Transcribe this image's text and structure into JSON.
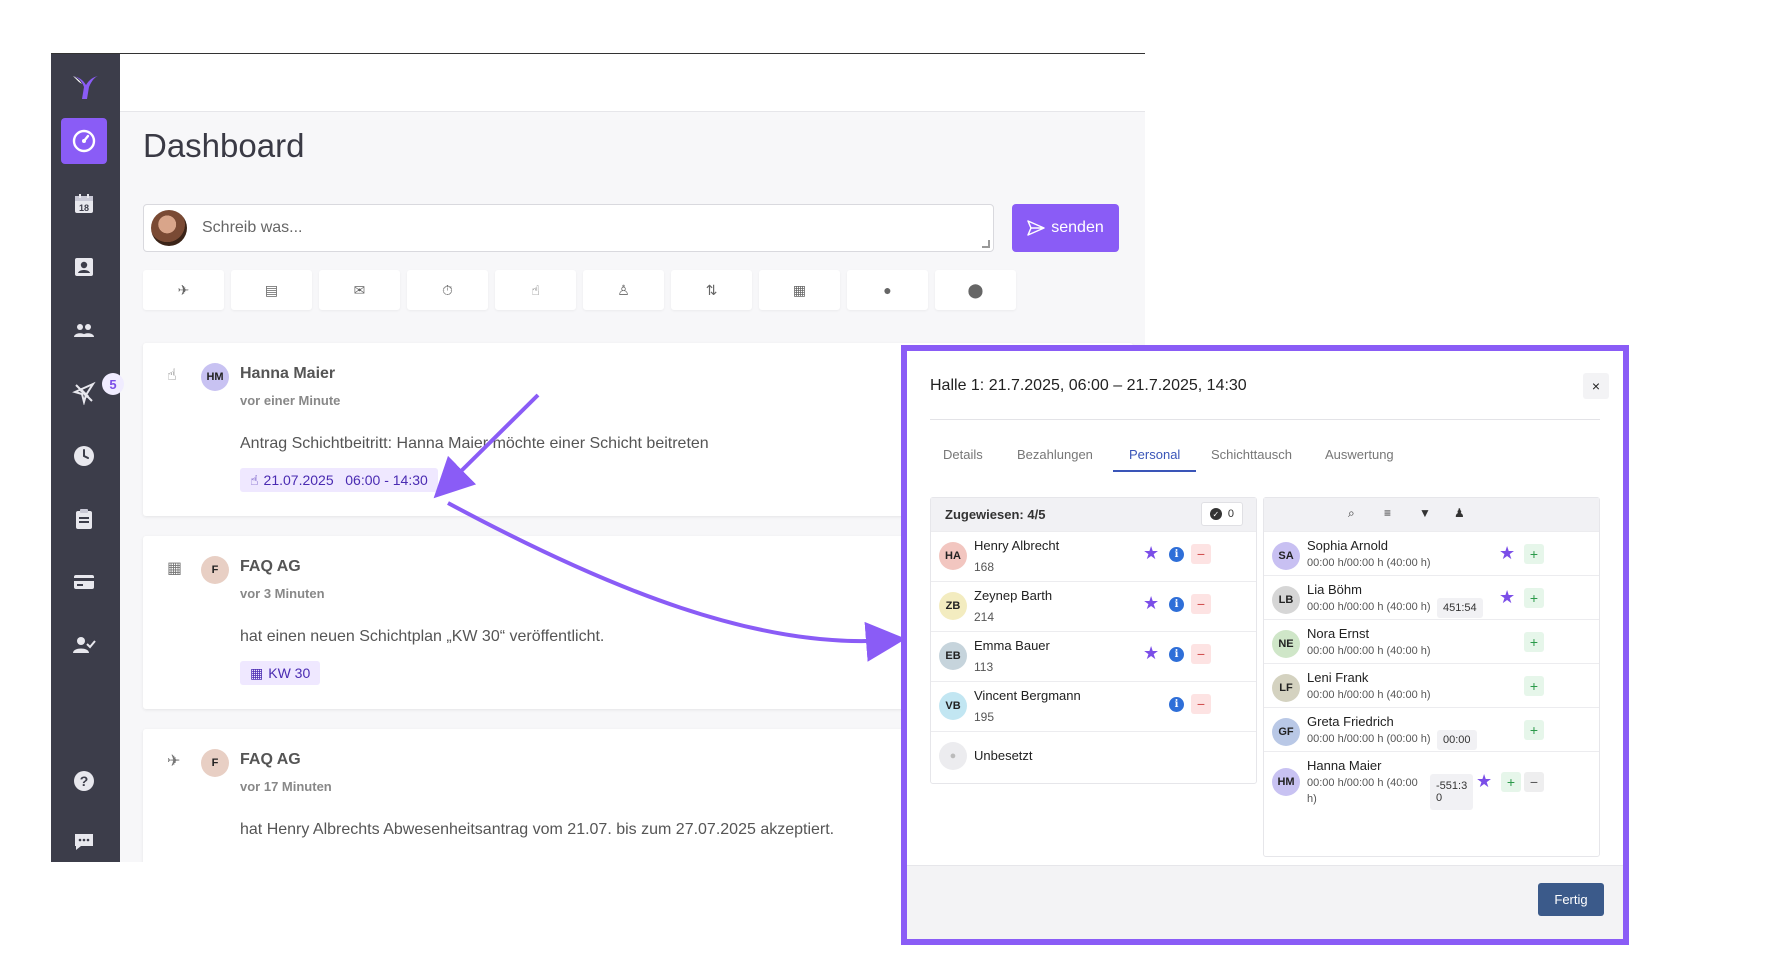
{
  "sidebar": {
    "badge_count": "5",
    "items": [
      {
        "name": "dashboard",
        "icon": "gauge-icon",
        "glyph": "◔",
        "active": true
      },
      {
        "name": "calendar",
        "icon": "calendar-icon",
        "glyph": "18"
      },
      {
        "name": "contacts",
        "icon": "contact-card-icon",
        "glyph": "👤"
      },
      {
        "name": "team",
        "icon": "users-icon",
        "glyph": "👥"
      },
      {
        "name": "absences",
        "icon": "airplane-icon",
        "glyph": "✈"
      },
      {
        "name": "time",
        "icon": "clock-icon",
        "glyph": "🕓"
      },
      {
        "name": "reports",
        "icon": "clipboard-icon",
        "glyph": "📋"
      },
      {
        "name": "payments",
        "icon": "credit-card-icon",
        "glyph": "💳"
      },
      {
        "name": "approvals",
        "icon": "user-check-icon",
        "glyph": "👤"
      },
      {
        "name": "help",
        "icon": "help-icon",
        "glyph": "?"
      },
      {
        "name": "chat",
        "icon": "chat-icon",
        "glyph": "💬"
      }
    ]
  },
  "dashboard": {
    "title": "Dashboard",
    "composer_placeholder": "Schreib was...",
    "send_label": "senden"
  },
  "quick_actions": [
    {
      "icon": "airplane-icon",
      "glyph": "✈"
    },
    {
      "icon": "clipboard-icon",
      "glyph": "▤"
    },
    {
      "icon": "mail-icon",
      "glyph": "✉"
    },
    {
      "icon": "stopwatch-icon",
      "glyph": "⏱"
    },
    {
      "icon": "hand-pointer-icon",
      "glyph": "☝"
    },
    {
      "icon": "person-add-icon",
      "glyph": "♙"
    },
    {
      "icon": "swap-icon",
      "glyph": "⇅"
    },
    {
      "icon": "calendar-icon",
      "glyph": "▦"
    },
    {
      "icon": "check-circle-icon",
      "glyph": "●"
    },
    {
      "icon": "location-pin-icon",
      "glyph": "⬤"
    }
  ],
  "feed": [
    {
      "icon": "hand-pointer-icon",
      "glyph": "☝",
      "initials": "HM",
      "avatar_color": "#c8c2f2",
      "name": "Hanna Maier",
      "time": "vor einer Minute",
      "text": "Antrag Schichtbeitritt: Hanna Maier möchte einer Schicht beitreten",
      "chip_icon": "☝",
      "chip": "21.07.2025   06:00 - 14:30"
    },
    {
      "icon": "calendar-icon",
      "glyph": "▦",
      "initials": "F",
      "avatar_color": "#e8cfc4",
      "name": "FAQ AG",
      "time": "vor 3 Minuten",
      "text": "hat einen neuen Schichtplan „KW 30“ veröffentlicht.",
      "chip_icon": "▦",
      "chip": "KW 30"
    },
    {
      "icon": "airplane-icon",
      "glyph": "✈",
      "initials": "F",
      "avatar_color": "#e8cfc4",
      "name": "FAQ AG",
      "time": "vor 17 Minuten",
      "text": "hat Henry Albrechts Abwesenheitsantrag vom 21.07. bis zum 27.07.2025 akzeptiert."
    }
  ],
  "modal": {
    "title": "Halle 1: 21.7.2025, 06:00 – 21.7.2025, 14:30",
    "close": "×",
    "tabs": [
      "Details",
      "Bezahlungen",
      "Personal",
      "Schichttausch",
      "Auswertung"
    ],
    "active_tab": "Personal",
    "assigned": {
      "title": "Zugewiesen: 4/5",
      "count": "0",
      "people": [
        {
          "initials": "HA",
          "name": "Henry Albrecht",
          "sub": "168",
          "color": "#f2c6c0",
          "star": true
        },
        {
          "initials": "ZB",
          "name": "Zeynep Barth",
          "sub": "214",
          "color": "#f3ecc0",
          "star": true
        },
        {
          "initials": "EB",
          "name": "Emma Bauer",
          "sub": "113",
          "color": "#c6d4dc",
          "star": true
        },
        {
          "initials": "VB",
          "name": "Vincent Bergmann",
          "sub": "195",
          "color": "#c2e6f2",
          "star": false
        }
      ],
      "unassigned_label": "Unbesetzt"
    },
    "available": {
      "people": [
        {
          "initials": "SA",
          "name": "Sophia Arnold",
          "sub": "00:00 h/00:00 h (40:00 h)",
          "color": "#c8c0f2",
          "star": true,
          "pill": ""
        },
        {
          "initials": "LB",
          "name": "Lia Böhm",
          "sub": "00:00 h/00:00 h (40:00 h)",
          "color": "#d6d6d6",
          "star": true,
          "pill": "451:54"
        },
        {
          "initials": "NE",
          "name": "Nora Ernst",
          "sub": "00:00 h/00:00 h (40:00 h)",
          "color": "#cfe6c8",
          "star": false,
          "pill": ""
        },
        {
          "initials": "LF",
          "name": "Leni Frank",
          "sub": "00:00 h/00:00 h (40:00 h)",
          "color": "#d4d2c0",
          "star": false,
          "pill": ""
        },
        {
          "initials": "GF",
          "name": "Greta Friedrich",
          "sub": "00:00 h/00:00 h (00:00 h)",
          "color": "#b9c8e6",
          "star": false,
          "pill": "00:00"
        },
        {
          "initials": "HM",
          "name": "Hanna Maier",
          "sub": "00:00 h/00:00 h (40:00",
          "sub2": "h)",
          "color": "#c8c2f2",
          "star": true,
          "pill": "-551:3",
          "pill2": "0"
        }
      ]
    },
    "done_label": "Fertig"
  },
  "colors": {
    "accent": "#8a5cf6",
    "sidebar": "#3c3d4a",
    "info": "#2f6fd8",
    "primary_button": "#3b5a8a"
  }
}
